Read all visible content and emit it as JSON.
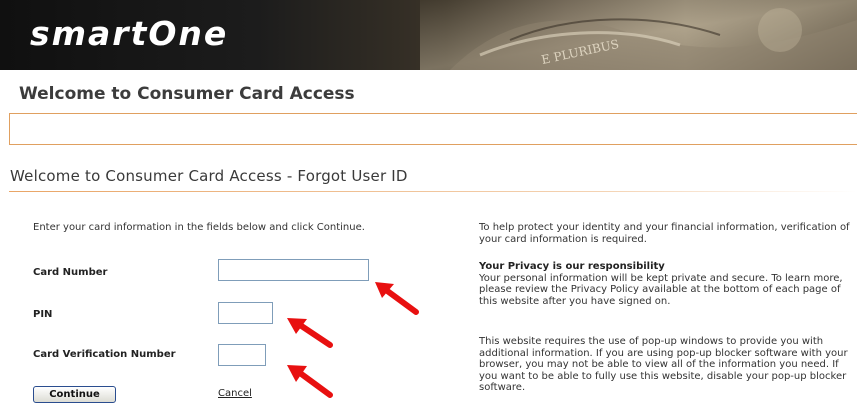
{
  "header": {
    "logo_text": "smartOne",
    "banner_text": "E PLURIBUS"
  },
  "page": {
    "welcome_title": "Welcome to Consumer Card Access",
    "sub_title": "Welcome to Consumer Card Access - Forgot User ID"
  },
  "form": {
    "intro": "Enter your card information in the fields below and click Continue.",
    "card_number_label": "Card Number",
    "card_number_value": "",
    "pin_label": "PIN",
    "pin_value": "",
    "cvn_label": "Card Verification Number",
    "cvn_value": "",
    "continue_label": "Continue",
    "cancel_label": "Cancel"
  },
  "info": {
    "identity_text": "To help protect your identity and your financial information, verification of your card information is required.",
    "privacy_heading": "Your Privacy is our responsibility",
    "privacy_text": "Your personal information will be kept private and secure. To learn more, please review the Privacy Policy available at the bottom of each page of this website after you have signed on.",
    "popup_text": "This website requires the use of pop-up windows to provide you with additional information. If you are using pop-up blocker software with your browser, you may not be able to view all of the information you need. If you want to be able to fully use this website, disable your pop-up blocker software."
  },
  "colors": {
    "arrow": "#e81010",
    "accent_rule": "#e9a566",
    "input_border": "#7f9db9"
  }
}
